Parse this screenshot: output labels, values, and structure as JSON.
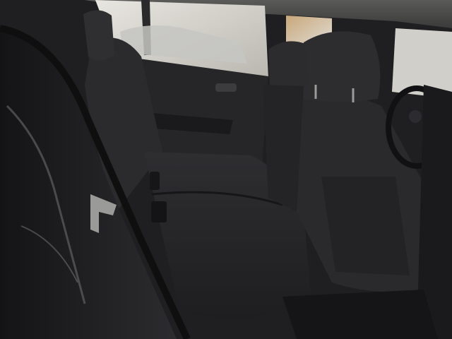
{
  "photo": {
    "palette": {
      "upholstery": "#2a2a2d",
      "upholstery_dark": "#1a1a1c",
      "door_panel": "#232325",
      "window_light": "#d8d8d4",
      "trim": "#3a3a3c",
      "metal": "#9a9a98"
    }
  }
}
